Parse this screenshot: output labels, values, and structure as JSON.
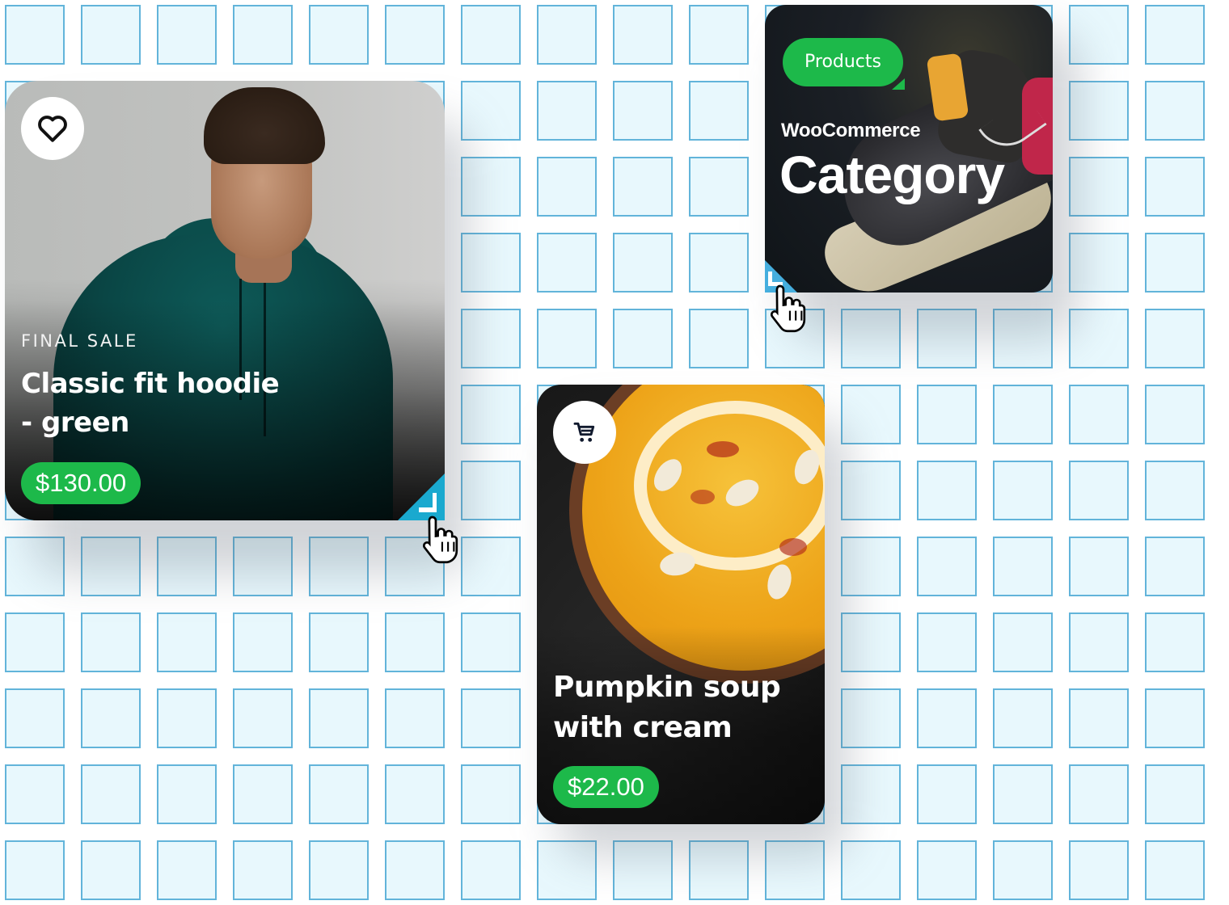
{
  "background": {
    "grid": {
      "columns": 16,
      "rows": 12,
      "cell_fill": "#e8f8fd",
      "cell_border": "#62b4da"
    }
  },
  "colors": {
    "accent_green": "#1db94a",
    "corner_blue": "#1aa9cf",
    "text_light": "#ffffff"
  },
  "cards": {
    "hoodie": {
      "icon": "heart-icon",
      "eyebrow": "FINAL SALE",
      "title": "Classic fit hoodie - green",
      "price": "$130.00",
      "resize_handle": "bottom-right"
    },
    "category": {
      "tag": "Products",
      "subtitle": "WooCommerce",
      "title": "Category",
      "resize_handle": "bottom-left"
    },
    "soup": {
      "icon": "cart-icon",
      "title": "Pumpkin soup with cream",
      "price": "$22.00"
    }
  },
  "cursors": [
    {
      "type": "hand-pointer",
      "near": "hoodie-card resize handle"
    },
    {
      "type": "hand-pointer",
      "near": "category-card resize handle"
    }
  ]
}
